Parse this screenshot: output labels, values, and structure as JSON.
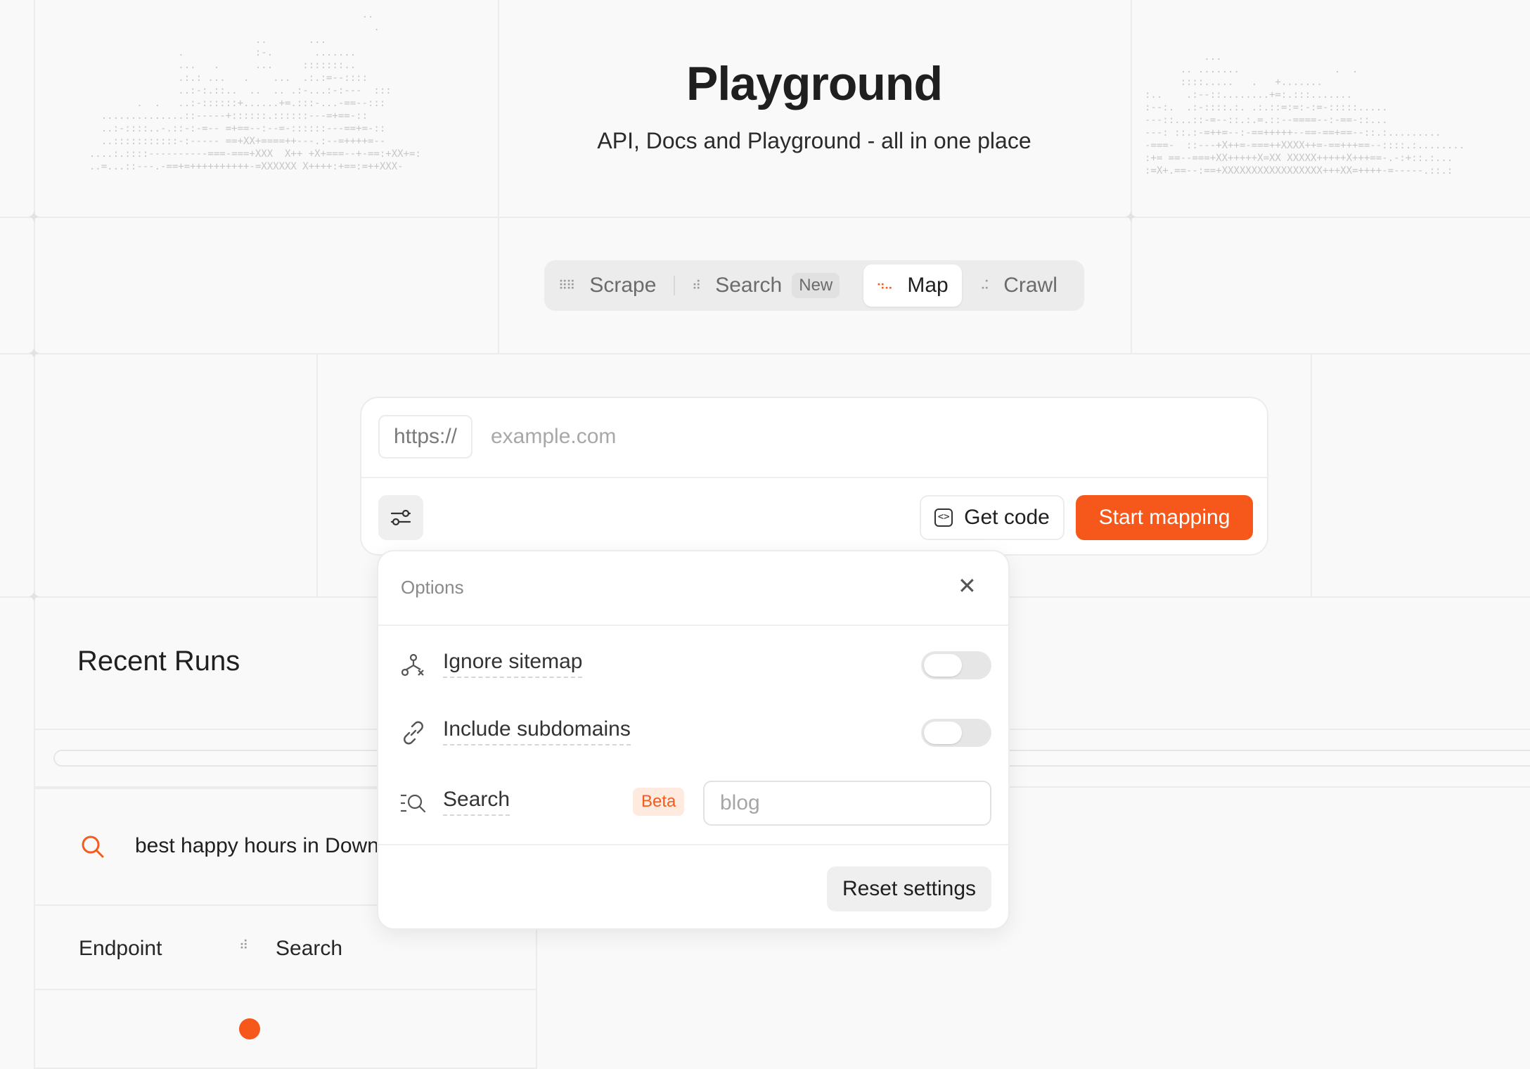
{
  "header": {
    "title": "Playground",
    "subtitle": "API, Docs and Playground - all in one place"
  },
  "tabs": [
    {
      "label": "Scrape",
      "icon": "scrape-icon"
    },
    {
      "label": "Search",
      "icon": "search-dots-icon",
      "badge": "New"
    },
    {
      "label": "Map",
      "icon": "map-icon",
      "active": true
    },
    {
      "label": "Crawl",
      "icon": "crawl-icon"
    }
  ],
  "url_input": {
    "protocol": "https://",
    "placeholder": "example.com"
  },
  "actions": {
    "get_code": "Get code",
    "start": "Start mapping"
  },
  "options": {
    "title": "Options",
    "ignore_sitemap": {
      "label": "Ignore sitemap",
      "enabled": false
    },
    "include_subdomains": {
      "label": "Include subdomains",
      "enabled": false
    },
    "search": {
      "label": "Search",
      "badge": "Beta",
      "placeholder": "blog"
    },
    "reset": "Reset settings"
  },
  "recent": {
    "title": "Recent Runs",
    "query": "best happy hours in Downt",
    "endpoint_label": "Endpoint",
    "endpoint_value": "Search"
  },
  "colors": {
    "accent": "#f5581a",
    "background": "#f9f9f9"
  }
}
